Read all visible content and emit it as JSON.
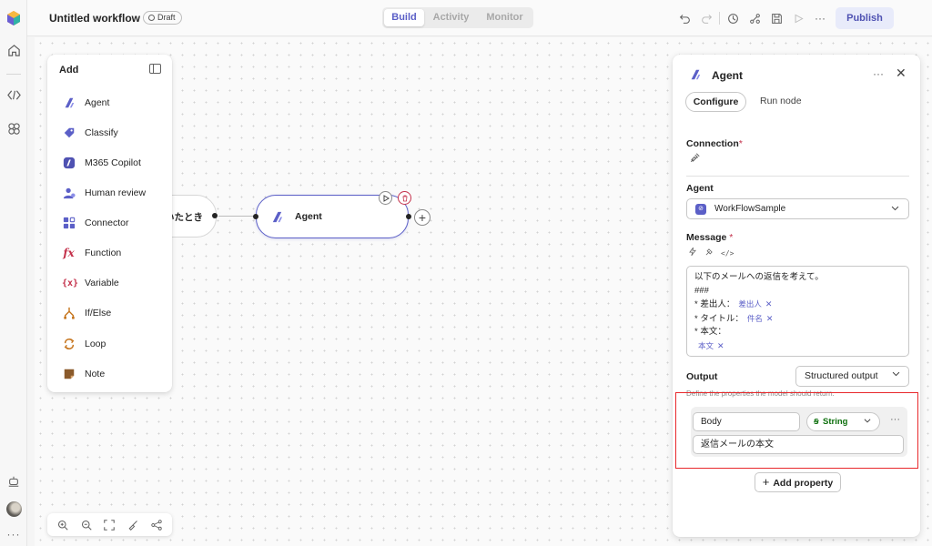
{
  "app": {
    "title": "Untitled workflow",
    "status": "Draft"
  },
  "modes": [
    {
      "label": "Build",
      "active": true
    },
    {
      "label": "Activity",
      "active": false
    },
    {
      "label": "Monitor",
      "active": false
    }
  ],
  "toolbar": {
    "publish_label": "Publish"
  },
  "add_panel": {
    "title": "Add",
    "items": [
      {
        "label": "Agent",
        "icon": "agent-icon",
        "color": "#5b5fc7"
      },
      {
        "label": "Classify",
        "icon": "tag-icon",
        "color": "#5b5fc7"
      },
      {
        "label": "M365 Copilot",
        "icon": "copilot-icon",
        "color": "#5b5fc7"
      },
      {
        "label": "Human review",
        "icon": "person-icon",
        "color": "#5b5fc7"
      },
      {
        "label": "Connector",
        "icon": "connector-icon",
        "color": "#5b5fc7"
      },
      {
        "label": "Function",
        "icon": "function-icon",
        "color": "#c4314b"
      },
      {
        "label": "Variable",
        "icon": "variable-icon",
        "color": "#c4314b"
      },
      {
        "label": "If/Else",
        "icon": "branch-icon",
        "color": "#c5731a"
      },
      {
        "label": "Loop",
        "icon": "loop-icon",
        "color": "#c5731a"
      },
      {
        "label": "Note",
        "icon": "note-icon",
        "color": "#8a5a2b"
      }
    ]
  },
  "canvas": {
    "trigger_node_label": "いたとき",
    "agent_node_label": "Agent"
  },
  "details_panel": {
    "title": "Agent",
    "tabs": [
      "Configure",
      "Run node"
    ],
    "connection_label": "Connection",
    "agent_label": "Agent",
    "agent_value": "WorkFlowSample",
    "message_label": "Message",
    "message_lines": [
      {
        "text": "以下のメールへの返信を考えて。",
        "token": ""
      },
      {
        "text": "###",
        "token": ""
      },
      {
        "text": "* 差出人：",
        "token": "差出人"
      },
      {
        "text": "* タイトル：",
        "token": "件名"
      },
      {
        "text": "* 本文：",
        "token": ""
      },
      {
        "text": "",
        "token": "本文"
      }
    ],
    "output_label": "Output",
    "output_value": "Structured output",
    "output_hint": "Define the properties the model should return.",
    "property": {
      "name": "Body",
      "type": "String",
      "description": "返信メールの本文"
    },
    "add_property_label": "Add property"
  }
}
